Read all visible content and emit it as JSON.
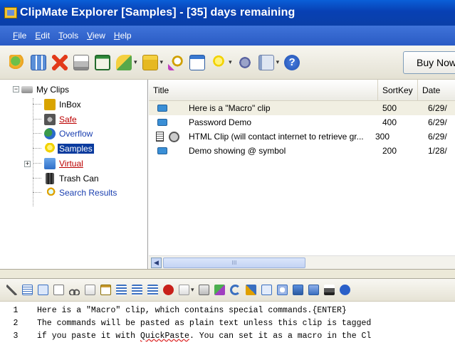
{
  "window": {
    "title": "ClipMate Explorer [Samples] - [35] days remaining"
  },
  "menu": [
    "File",
    "Edit",
    "Tools",
    "View",
    "Help"
  ],
  "toolbar": {
    "buy_now_label": "Buy Now",
    "icons": [
      "pushpin-icon",
      "grid-icon",
      "delete-icon",
      "print-icon",
      "copy-clipboard-icon",
      "paste-icon",
      "folder-move-icon",
      "search-icon",
      "window-icon",
      "bulb-icon",
      "tool-icon",
      "format-icon",
      "help-icon"
    ]
  },
  "tree": {
    "root": "My Clips",
    "items": [
      {
        "label": "InBox",
        "style": "normal",
        "icon": "inbox-icon",
        "color": "#d9a400"
      },
      {
        "label": "Safe",
        "style": "link",
        "icon": "safe-icon",
        "color": "#555555"
      },
      {
        "label": "Overflow",
        "style": "blue",
        "icon": "overflow-icon",
        "color": "#2a8a3a"
      },
      {
        "label": "Samples",
        "style": "selected",
        "icon": "bulb-icon",
        "color": "#f2d200"
      },
      {
        "label": "Virtual",
        "style": "link",
        "icon": "folder-icon",
        "color": "#3c7fd4"
      },
      {
        "label": "Trash Can",
        "style": "normal",
        "icon": "trash-icon",
        "color": "#333333"
      },
      {
        "label": "Search Results",
        "style": "blue",
        "icon": "search-icon",
        "color": "#e0a000"
      }
    ]
  },
  "list": {
    "columns": [
      "Title",
      "SortKey",
      "Date"
    ],
    "rows": [
      {
        "title": "Here is a \"Macro\" clip",
        "sortkey": "500",
        "date": "6/29/",
        "selected": true
      },
      {
        "title": "Password Demo",
        "sortkey": "400",
        "date": "6/29/",
        "selected": false
      },
      {
        "title": "HTML Clip (will contact internet to retrieve gr...",
        "sortkey": "300",
        "date": "6/29/",
        "selected": false
      },
      {
        "title": "Demo showing @ symbol",
        "sortkey": "200",
        "date": "1/28/",
        "selected": false
      }
    ],
    "scroll_thumb": "III"
  },
  "editor": {
    "lines": [
      {
        "num": "1",
        "text": "Here is a \"Macro\" clip, which contains special commands.{ENTER}"
      },
      {
        "num": "2",
        "text": "The commands will be pasted as plain text unless this clip is tagged"
      },
      {
        "num": "3",
        "pre": "if you paste it with ",
        "squiggle": "QuickPaste",
        "post": ". You can set it as a macro in the Cl"
      }
    ]
  }
}
